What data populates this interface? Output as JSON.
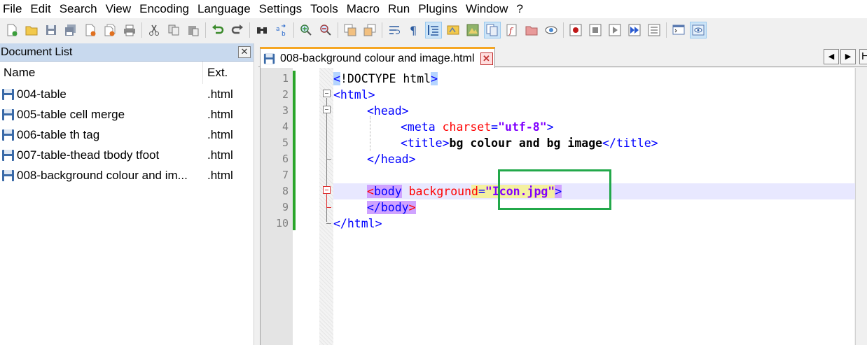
{
  "menu": [
    "File",
    "Edit",
    "Search",
    "View",
    "Encoding",
    "Language",
    "Settings",
    "Tools",
    "Macro",
    "Run",
    "Plugins",
    "Window",
    "?"
  ],
  "toolbar": {
    "buttons": [
      "new-file-icon",
      "open-file-icon",
      "save-icon",
      "save-all-icon",
      "close-icon",
      "close-all-icon",
      "print-icon",
      "cut-icon",
      "copy-icon",
      "paste-icon",
      "undo-icon",
      "redo-icon",
      "find-icon",
      "replace-icon",
      "zoom-in-icon",
      "zoom-out-icon",
      "sync-vertical-icon",
      "sync-horizontal-icon",
      "word-wrap-icon",
      "show-all-chars-icon",
      "indent-guide-icon",
      "user-language-icon",
      "document-map-icon",
      "document-list-icon",
      "function-list-icon",
      "folder-as-workspace-icon",
      "monitoring-icon",
      "record-macro-icon",
      "stop-record-icon",
      "playback-icon",
      "run-macro-multiple-icon",
      "save-macro-icon",
      "console-icon",
      "preview-icon"
    ],
    "active_buttons": [
      "indent-guide-icon",
      "document-list-icon",
      "preview-icon"
    ]
  },
  "doclist": {
    "title": "Document List",
    "close_symbol": "✕",
    "col_name": "Name",
    "col_ext": "Ext.",
    "rows": [
      {
        "name": "004-table",
        "ext": ".html"
      },
      {
        "name": "005-table cell merge",
        "ext": ".html"
      },
      {
        "name": "006-table th tag",
        "ext": ".html"
      },
      {
        "name": "007-table-thead tbody tfoot",
        "ext": ".html"
      },
      {
        "name": "008-background colour and im...",
        "ext": ".html"
      }
    ]
  },
  "tab": {
    "label": "008-background colour and image.html",
    "close_symbol": "✕",
    "nav_prev": "◀",
    "nav_next": "▶",
    "overflow": "H"
  },
  "editor": {
    "line_numbers": [
      "1",
      "2",
      "3",
      "4",
      "5",
      "6",
      "7",
      "8",
      "9",
      "10"
    ],
    "line1": {
      "p1": "<",
      "p2": "!DOCTYPE html",
      "p3": ">"
    },
    "line2": {
      "tag": "<html>"
    },
    "line3": {
      "tag": "<head>"
    },
    "line4": {
      "t1": "<meta ",
      "attr": "charset",
      "eq": "=",
      "val": "\"utf-8\"",
      "t2": ">"
    },
    "line5": {
      "t1": "<title>",
      "text": "bg colour and bg image",
      "t2": "</title>"
    },
    "line6": {
      "tag": "</head>"
    },
    "line8": {
      "lt": "<",
      "name": "body",
      "sp": " ",
      "attr": "backgroun",
      "attr_end": "d",
      "eq": "=",
      "val": "\"Icon.jpg\"",
      "gt": ">"
    },
    "line9": {
      "t1": "</body",
      "t2": ">"
    },
    "line10": {
      "tag": "</html>"
    }
  },
  "colors": {
    "highlight_box": "#22a84a",
    "change_bar": "#2aa52a",
    "tag": "#0000ff",
    "attribute": "#ff0000",
    "string": "#8000ff",
    "current_line": "#e8e8ff"
  }
}
